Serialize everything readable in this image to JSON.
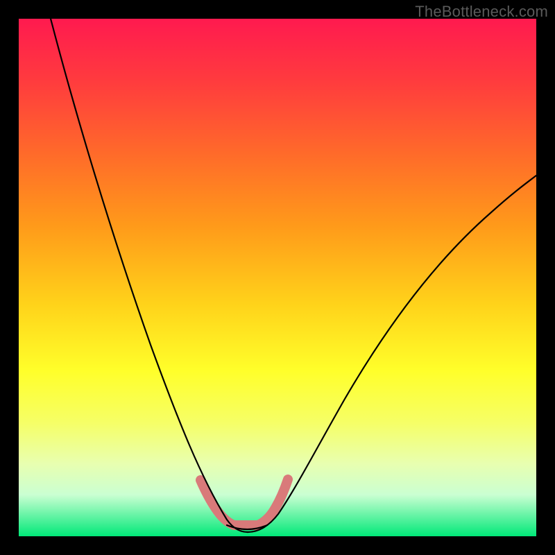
{
  "watermark": "TheBottleneck.com",
  "colors": {
    "curve": "#000000",
    "highlight": "#d97a7a",
    "gradient_top": "#ff1a4f",
    "gradient_bottom": "#00e878"
  },
  "chart_data": {
    "type": "line",
    "title": "",
    "xlabel": "",
    "ylabel": "",
    "xlim": [
      0,
      100
    ],
    "ylim": [
      0,
      100
    ],
    "series": [
      {
        "name": "left-branch",
        "x": [
          6,
          10,
          14,
          18,
          22,
          26,
          30,
          33,
          36,
          38,
          40
        ],
        "y": [
          100,
          84,
          68,
          54,
          42,
          31,
          21,
          13,
          7,
          3,
          1
        ]
      },
      {
        "name": "right-branch",
        "x": [
          48,
          52,
          56,
          60,
          66,
          72,
          80,
          88,
          96,
          100
        ],
        "y": [
          1,
          4,
          9,
          15,
          24,
          33,
          44,
          54,
          63,
          68
        ]
      },
      {
        "name": "valley-floor",
        "x": [
          40,
          42,
          44,
          46,
          48
        ],
        "y": [
          1,
          0,
          0,
          0,
          1
        ]
      },
      {
        "name": "pink-highlight",
        "x": [
          35,
          37,
          39,
          41,
          43,
          45,
          47,
          49,
          51
        ],
        "y": [
          10,
          6,
          3,
          1,
          0,
          0,
          1,
          3,
          7
        ]
      }
    ]
  }
}
